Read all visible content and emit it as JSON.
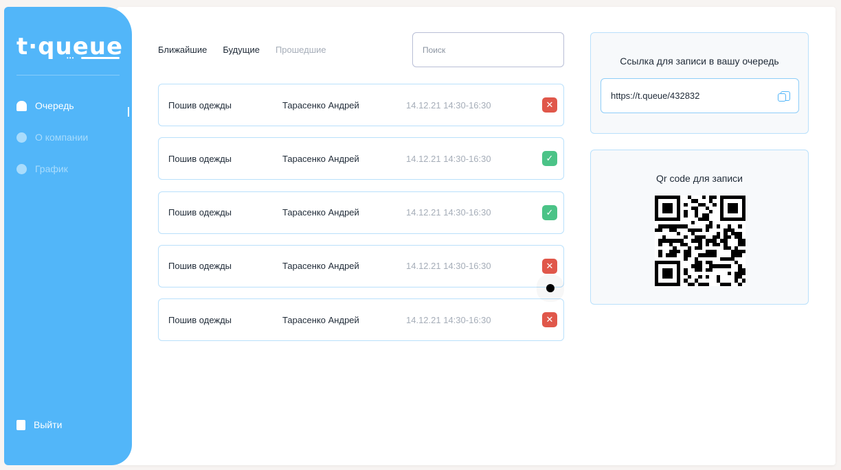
{
  "brand": {
    "logo": "t·queue"
  },
  "sidebar": {
    "items": [
      {
        "label": "Очередь",
        "icon": "home-icon",
        "active": true
      },
      {
        "label": "О компании",
        "icon": "gear-icon"
      },
      {
        "label": "График",
        "icon": "clock-icon"
      }
    ],
    "logout": "Выйти"
  },
  "tabs": [
    {
      "label": "Ближайшие"
    },
    {
      "label": "Будущие"
    },
    {
      "label": "Прошедшие"
    }
  ],
  "search": {
    "placeholder": "Поиск",
    "value": ""
  },
  "rows": [
    {
      "service": "Пошив одежды",
      "client": "Тарасенко Андрей",
      "time": "14.12.21 14:30-16:30",
      "status": "cancelled"
    },
    {
      "service": "Пошив одежды",
      "client": "Тарасенко Андрей",
      "time": "14.12.21 14:30-16:30",
      "status": "confirmed"
    },
    {
      "service": "Пошив одежды",
      "client": "Тарасенко Андрей",
      "time": "14.12.21 14:30-16:30",
      "status": "confirmed"
    },
    {
      "service": "Пошив одежды",
      "client": "Тарасенко Андрей",
      "time": "14.12.21 14:30-16:30",
      "status": "cancelled"
    },
    {
      "service": "Пошив одежды",
      "client": "Тарасенко Андрей",
      "time": "14.12.21 14:30-16:30",
      "status": "cancelled"
    }
  ],
  "link_panel": {
    "title": "Ссылка для записи в вашу очередь",
    "url": "https://t.queue/432832"
  },
  "qr_panel": {
    "title": "Qr code для записи"
  },
  "colors": {
    "accent": "#52b6f9",
    "cancel": "#e0574a",
    "ok": "#4bc387"
  }
}
